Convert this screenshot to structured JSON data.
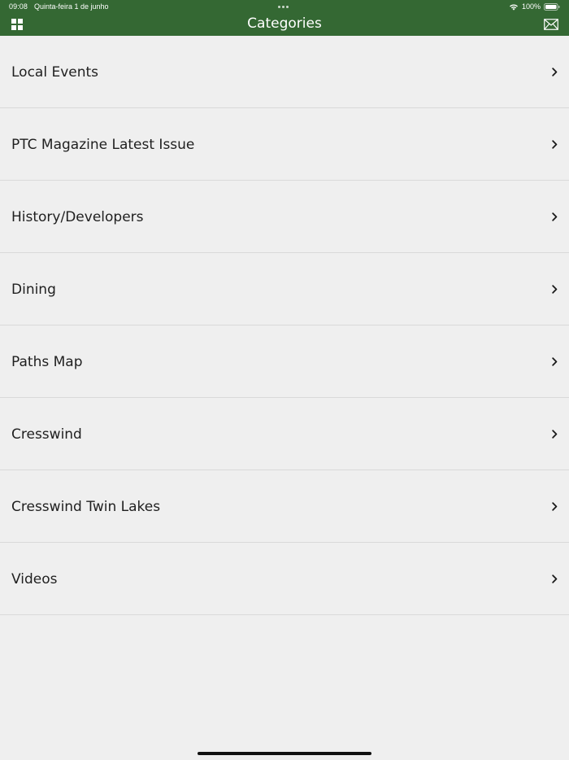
{
  "status_bar": {
    "time": "09:08",
    "date": "Quinta-feira 1 de junho",
    "battery": "100%"
  },
  "nav": {
    "title": "Categories",
    "left_icon": "grid-icon",
    "right_icon": "mail-icon"
  },
  "categories": [
    {
      "label": "Local Events"
    },
    {
      "label": "PTC Magazine Latest Issue"
    },
    {
      "label": "History/Developers"
    },
    {
      "label": "Dining"
    },
    {
      "label": "Paths Map"
    },
    {
      "label": "Cresswind"
    },
    {
      "label": "Cresswind Twin Lakes"
    },
    {
      "label": "Videos"
    }
  ],
  "colors": {
    "header": "#346833",
    "background": "#efefef",
    "text": "#1f1f1f"
  }
}
